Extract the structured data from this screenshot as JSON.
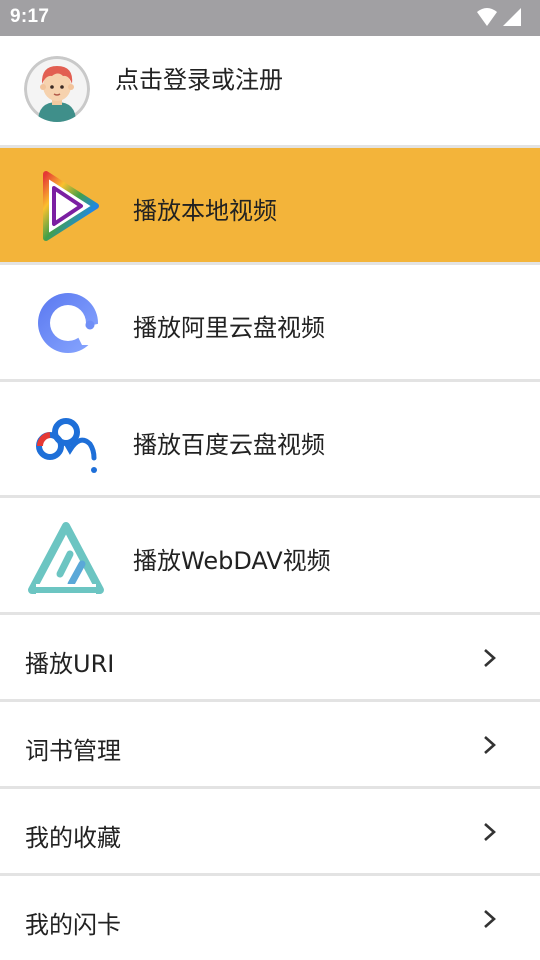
{
  "status_bar": {
    "time": "9:17",
    "icons": [
      "wifi-icon",
      "signal-icon"
    ]
  },
  "header": {
    "avatar_icon": "avatar-boy",
    "login_text": "点击登录或注册"
  },
  "sources": [
    {
      "icon": "local-play-icon",
      "label": "播放本地视频",
      "active": true,
      "active_color": "#f3b43a"
    },
    {
      "icon": "aliyun-drive-icon",
      "label": "播放阿里云盘视频",
      "active": false
    },
    {
      "icon": "baidu-cloud-icon",
      "label": "播放百度云盘视频",
      "active": false
    },
    {
      "icon": "webdav-icon",
      "label": "播放WebDAV视频",
      "active": false
    }
  ],
  "menu": [
    {
      "label": "播放URI",
      "icon": "chevron-right-icon"
    },
    {
      "label": "词书管理",
      "icon": "chevron-right-icon"
    },
    {
      "label": "我的收藏",
      "icon": "chevron-right-icon"
    },
    {
      "label": "我的闪卡",
      "icon": "chevron-right-icon"
    }
  ]
}
